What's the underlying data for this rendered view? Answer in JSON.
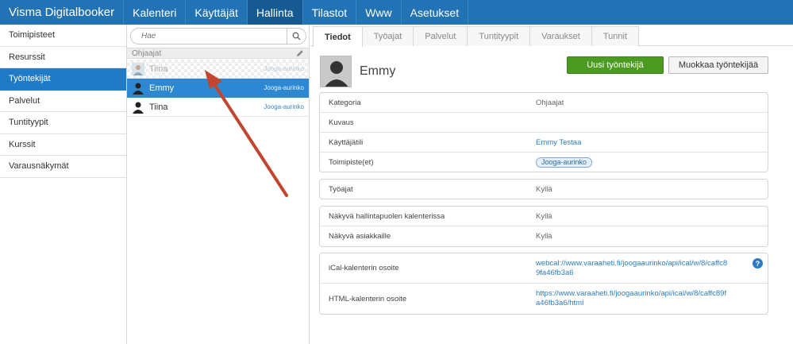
{
  "app": {
    "brand": "Visma Digitalbooker"
  },
  "nav": [
    {
      "label": "Kalenteri",
      "active": false
    },
    {
      "label": "Käyttäjät",
      "active": false
    },
    {
      "label": "Hallinta",
      "active": true
    },
    {
      "label": "Tilastot",
      "active": false
    },
    {
      "label": "Www",
      "active": false
    },
    {
      "label": "Asetukset",
      "active": false
    }
  ],
  "sidebar": {
    "items": [
      {
        "label": "Toimipisteet"
      },
      {
        "label": "Resurssit"
      },
      {
        "label": "Työntekijät",
        "active": true
      },
      {
        "label": "Palvelut"
      },
      {
        "label": "Tuntityypit"
      },
      {
        "label": "Kurssit"
      },
      {
        "label": "Varausnäkymät"
      }
    ]
  },
  "list": {
    "search_placeholder": "Hae",
    "group": "Ohjaajat",
    "rows": [
      {
        "name": "Tiina",
        "location": "Jooga-aurinko",
        "state": "dragging"
      },
      {
        "name": "Emmy",
        "location": "Jooga-aurinko",
        "state": "selected"
      },
      {
        "name": "Tiina",
        "location": "Jooga-aurinko",
        "state": "normal"
      }
    ]
  },
  "tabs": [
    {
      "label": "Tiedot",
      "active": true
    },
    {
      "label": "Työajat"
    },
    {
      "label": "Palvelut"
    },
    {
      "label": "Tuntityypit"
    },
    {
      "label": "Varaukset"
    },
    {
      "label": "Tunnit"
    }
  ],
  "employee": {
    "name": "Emmy",
    "new_button": "Uusi työntekijä",
    "edit_button": "Muokkaa työntekijää"
  },
  "details": {
    "card1": [
      {
        "label": "Kategoria",
        "value": "Ohjaajat"
      },
      {
        "label": "Kuvaus",
        "value": ""
      },
      {
        "label": "Käyttäjätili",
        "value": "Emmy Testaa"
      },
      {
        "label": "Toimipiste(et)",
        "value": "Jooga-aurinko"
      }
    ],
    "card2": [
      {
        "label": "Työajat",
        "value": "Kyllä"
      }
    ],
    "card3": [
      {
        "label": "Näkyvä hallintapuolen kalenterissa",
        "value": "Kyllä"
      },
      {
        "label": "Näkyvä asiakkaille",
        "value": "Kyllä"
      }
    ],
    "card4": [
      {
        "label": "iCal-kalenterin osoite",
        "value_line1": "webcal://www.varaaheti.fi/joogaaurinko/api/ical/w/8/caffc8",
        "value_line2": "9fa46fb3a6"
      },
      {
        "label": "HTML-kalenterin osoite",
        "value_line1": "https://www.varaaheti.fi/joogaaurinko/api/ical/w/8/caffc89f",
        "value_line2": "a46fb3a6/html"
      }
    ]
  },
  "icons": {
    "search": "search-icon",
    "edit": "pencil-icon",
    "help": "?",
    "avatar": "person-silhouette"
  },
  "colors": {
    "nav_bg": "#2273b5",
    "nav_active": "#175a92",
    "selected": "#2d88d3",
    "primary_button": "#4a9b20",
    "link": "#2b7cc3",
    "arrow": "#c2462f"
  }
}
